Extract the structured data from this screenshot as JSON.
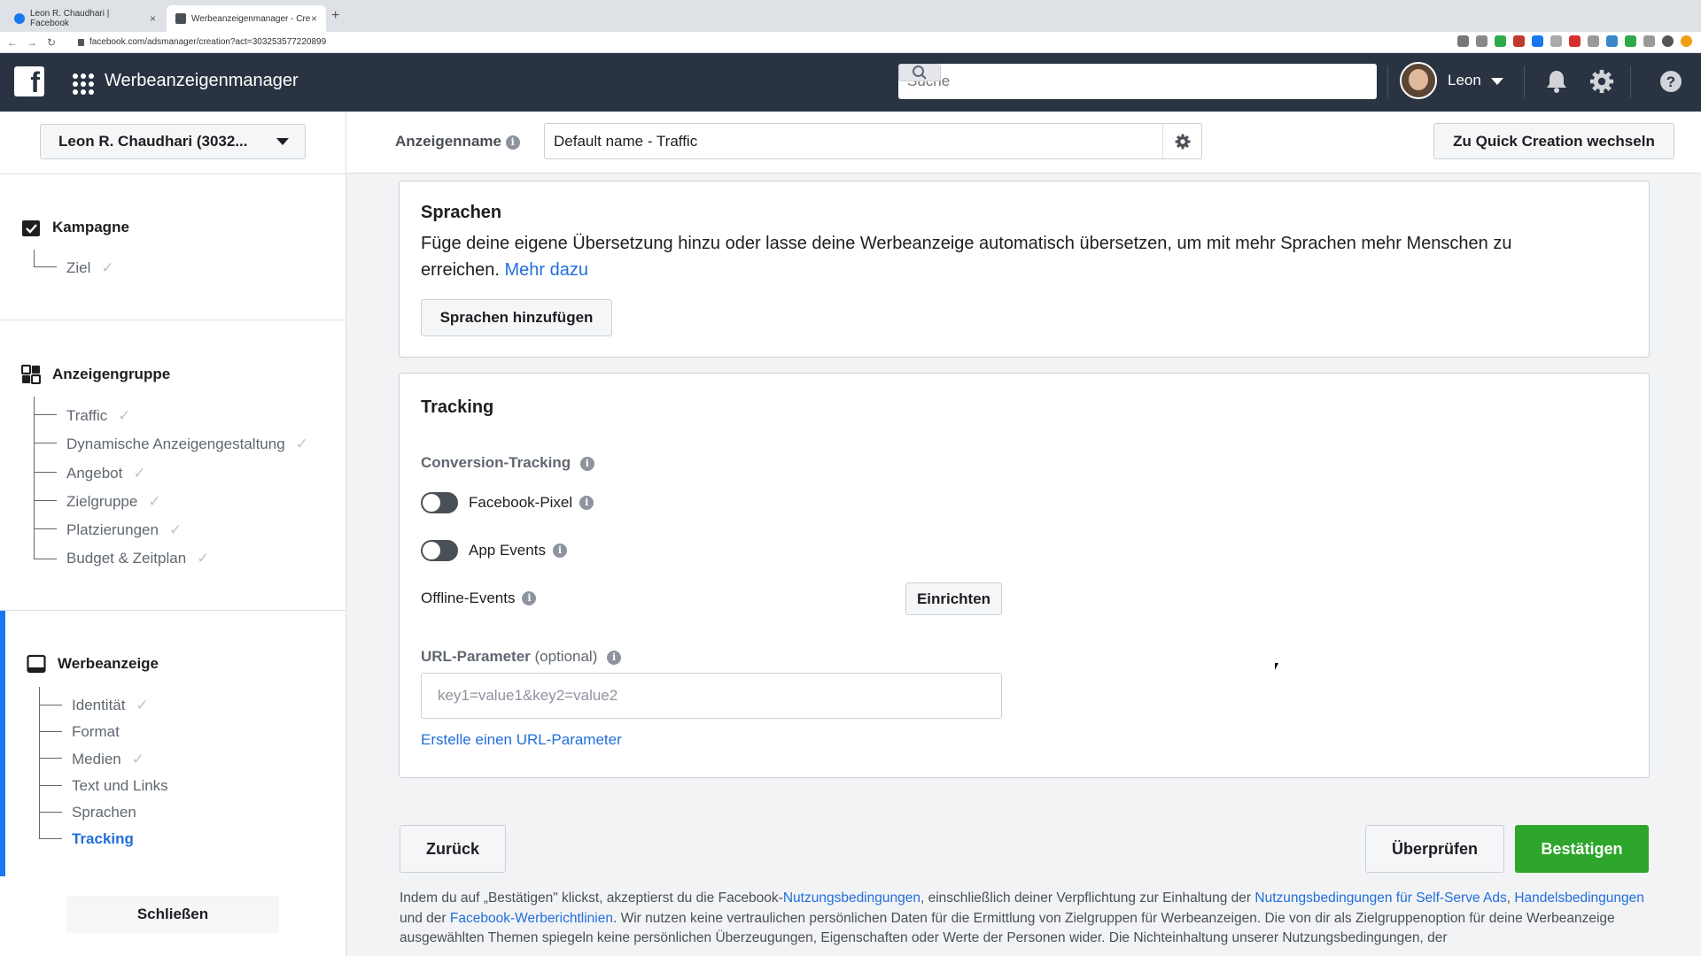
{
  "browser": {
    "tabs": [
      {
        "title": "Leon R. Chaudhari | Facebook",
        "close": "×"
      },
      {
        "title": "Werbeanzeigenmanager - Cre",
        "close": "×"
      }
    ],
    "new_tab": "+",
    "url": "facebook.com/adsmanager/creation?act=303253577220899"
  },
  "topbar": {
    "brand": "Werbeanzeigenmanager",
    "search_placeholder": "Suche",
    "user_name": "Leon"
  },
  "header": {
    "account": "Leon R. Chaudhari (3032...",
    "ad_name_label": "Anzeigenname",
    "ad_name_value": "Default name - Traffic",
    "quick_creation": "Zu Quick Creation wechseln"
  },
  "sidebar": {
    "kampagne": {
      "title": "Kampagne",
      "items": [
        {
          "label": "Ziel",
          "done": true
        }
      ]
    },
    "anzeigengruppe": {
      "title": "Anzeigengruppe",
      "items": [
        {
          "label": "Traffic",
          "done": true
        },
        {
          "label": "Dynamische Anzeigengestaltung",
          "done": true
        },
        {
          "label": "Angebot",
          "done": true
        },
        {
          "label": "Zielgruppe",
          "done": true
        },
        {
          "label": "Platzierungen",
          "done": true
        },
        {
          "label": "Budget & Zeitplan",
          "done": true
        }
      ]
    },
    "werbeanzeige": {
      "title": "Werbeanzeige",
      "items": [
        {
          "label": "Identität",
          "done": true
        },
        {
          "label": "Format",
          "done": false
        },
        {
          "label": "Medien",
          "done": true
        },
        {
          "label": "Text und Links",
          "done": false
        },
        {
          "label": "Sprachen",
          "done": false
        },
        {
          "label": "Tracking",
          "done": false,
          "active": true
        }
      ]
    },
    "close": "Schließen"
  },
  "languages": {
    "title": "Sprachen",
    "text": "Füge deine eigene Übersetzung hinzu oder lasse deine Werbeanzeige automatisch übersetzen, um mit mehr Sprachen mehr Menschen zu erreichen.",
    "text_line1": "Füge deine eigene Übersetzung hinzu oder lasse deine Werbeanzeige automatisch übersetzen, um mit mehr Sprachen mehr Menschen zu",
    "text_line2": "erreichen.",
    "link": "Mehr dazu",
    "button": "Sprachen hinzufügen"
  },
  "tracking": {
    "title": "Tracking",
    "conversion_label": "Conversion-Tracking",
    "facebook_pixel": "Facebook-Pixel",
    "facebook_pixel_on": false,
    "app_events": "App Events",
    "app_events_on": false,
    "offline_events": "Offline-Events",
    "setup_button": "Einrichten",
    "url_param_label": "URL-Parameter",
    "url_param_optional": "(optional)",
    "url_param_placeholder": "key1=value1&key2=value2",
    "url_param_link": "Erstelle einen URL-Parameter"
  },
  "footer": {
    "back": "Zurück",
    "review": "Überprüfen",
    "confirm": "Bestätigen",
    "legal_1": "Indem du auf „Bestätigen\" klickst, akzeptierst du die Facebook-",
    "legal_link_1": "Nutzungsbedingungen",
    "legal_2": ", einschließlich deiner Verpflichtung zur Einhaltung der ",
    "legal_link_2": "Nutzungsbedingungen für Self-Serve Ads",
    "legal_3": ",",
    "legal_link_3": "Handelsbedingungen",
    "legal_4": " und der ",
    "legal_link_4": "Facebook-Werberichtlinien",
    "legal_5": ". Wir nutzen keine vertraulichen persönlichen Daten für die Ermittlung von Zielgruppen für Werbeanzeigen. Die von dir als Zielgruppenoption für deine Werbeanzeige ausgewählten Themen spiegeln keine persönlichen Überzeugungen, Eigenschaften oder Werte der Personen wider. Die Nichteinhaltung unserer Nutzungsbedingungen, der"
  },
  "colors": {
    "topbar": "#293341",
    "link": "#216fdb",
    "confirm": "#36a420"
  }
}
